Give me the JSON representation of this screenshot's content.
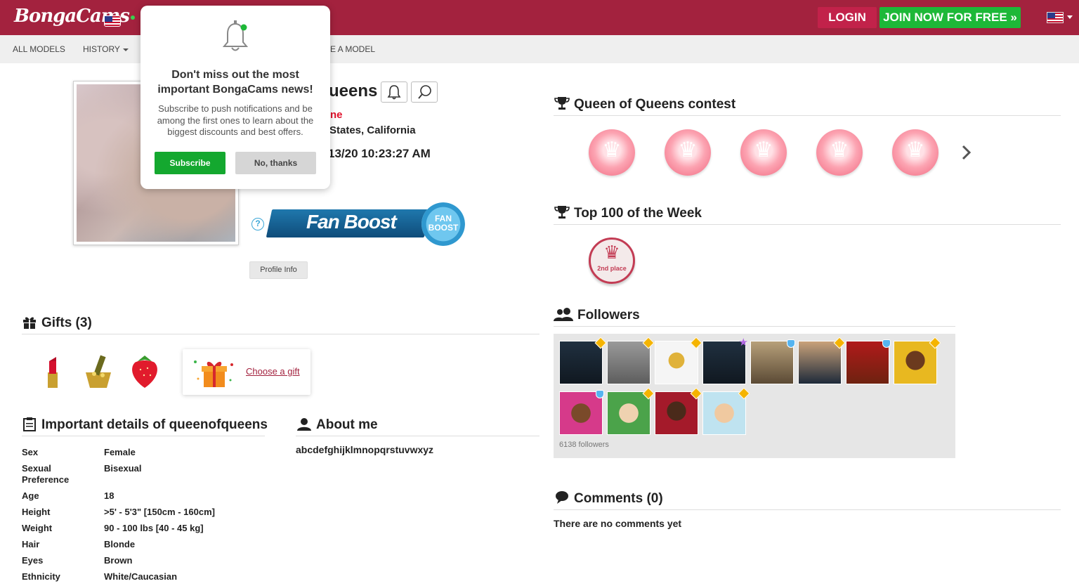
{
  "header": {
    "logo_text": "BongaCams",
    "login_label": "LOGIN",
    "join_label": "JOIN NOW FOR FREE »"
  },
  "nav": {
    "items": [
      {
        "label": "ALL MODELS"
      },
      {
        "label": "HISTORY"
      },
      {
        "label": "ME A MODEL"
      }
    ]
  },
  "profile": {
    "name_partial": "ueens",
    "status_partial": "ne",
    "location_partial": "States, California",
    "lastseen_partial": "13/20 10:23:27 AM",
    "fanboost_label": "Fan Boost",
    "fanboost_badge": "FAN BOOST",
    "help_glyph": "?",
    "profile_info_label": "Profile Info"
  },
  "gifts": {
    "title": "Gifts (3)",
    "choose_label": "Choose a gift"
  },
  "details": {
    "title": "Important details of queenofqueens",
    "rows": [
      {
        "label": "Sex",
        "value": "Female"
      },
      {
        "label": "Sexual Preference",
        "value": "Bisexual"
      },
      {
        "label": "Age",
        "value": "18"
      },
      {
        "label": "Height",
        "value": ">5' - 5'3\" [150cm - 160cm]"
      },
      {
        "label": "Weight",
        "value": "90 - 100 lbs [40 - 45 kg]"
      },
      {
        "label": "Hair",
        "value": "Blonde"
      },
      {
        "label": "Eyes",
        "value": "Brown"
      },
      {
        "label": "Ethnicity",
        "value": "White/Caucasian"
      }
    ]
  },
  "about": {
    "title": "About me",
    "text": "abcdefghijklmnopqrstuvwxyz"
  },
  "contest": {
    "title": "Queen of Queens contest"
  },
  "top100": {
    "title": "Top 100 of the Week",
    "place_label": "2nd place"
  },
  "followers": {
    "title": "Followers",
    "count_text": "6138 followers"
  },
  "comments": {
    "title": "Comments (0)",
    "empty_text": "There are no comments yet"
  },
  "popup": {
    "title": "Don't miss out the most important BongaCams news!",
    "text": "Subscribe to push notifications and be among the first ones to learn about the biggest discounts and best offers.",
    "subscribe_label": "Subscribe",
    "no_thanks_label": "No, thanks"
  },
  "colors": {
    "brand": "#a3223e",
    "join_green": "#1db838",
    "status_red": "#e0102a",
    "subscribe_green": "#14a82f"
  }
}
